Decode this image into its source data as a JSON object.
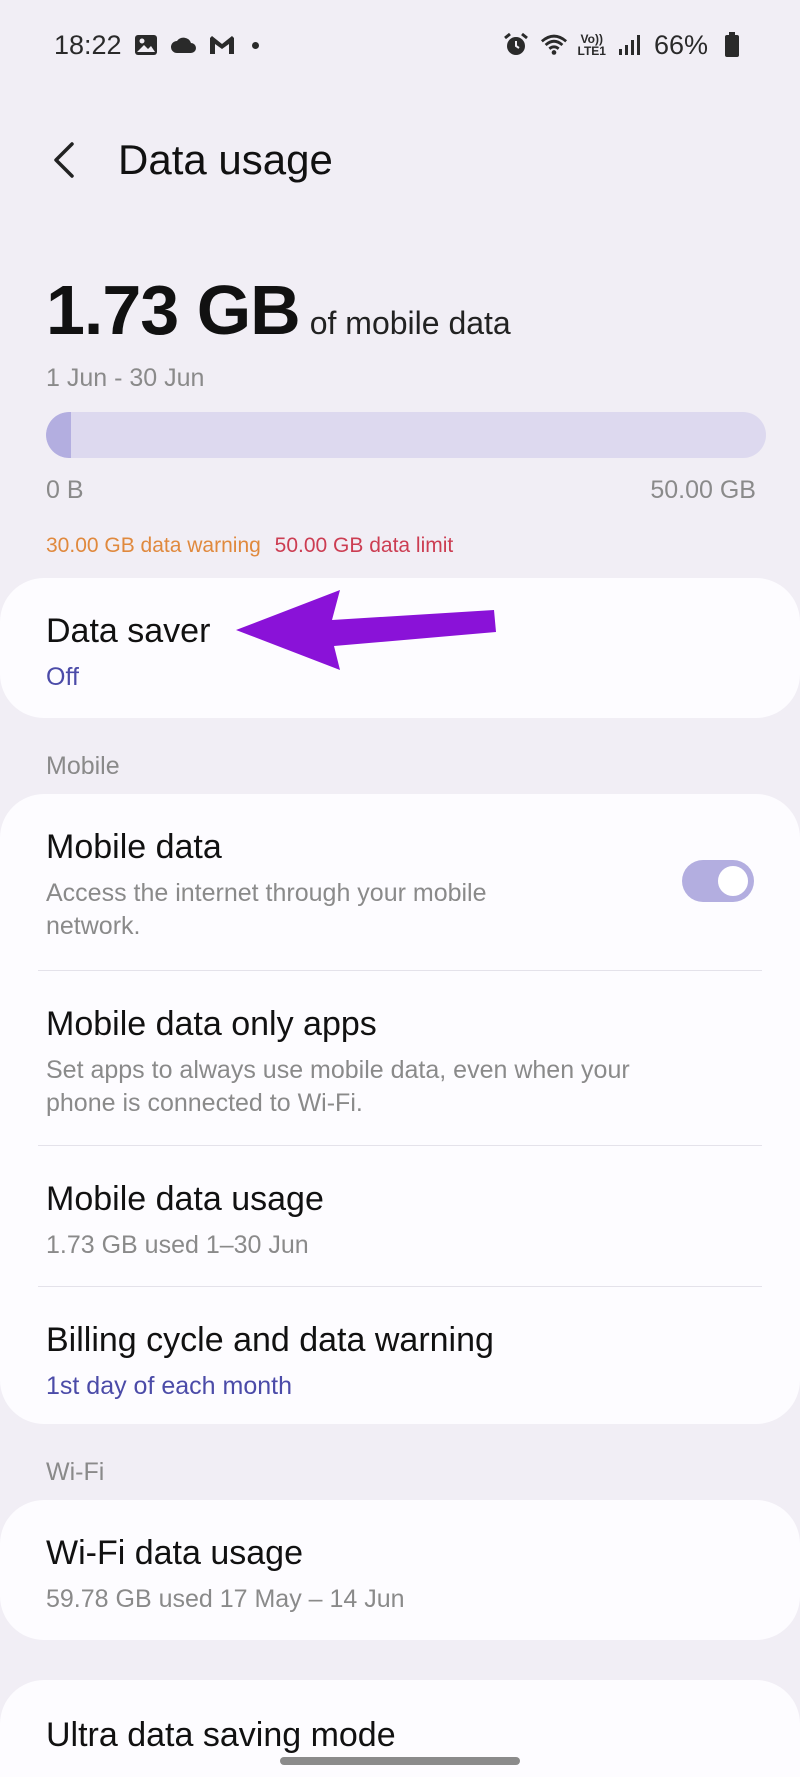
{
  "status_bar": {
    "time": "18:22",
    "left_icons": [
      "gallery-icon",
      "cloud-icon",
      "gmail-icon"
    ],
    "right_icons": [
      "alarm-icon",
      "wifi-icon",
      "volte-lte-icon",
      "signal-icon"
    ],
    "volte_top": "Vo))",
    "volte_bottom": "LTE1",
    "battery": "66%"
  },
  "header": {
    "title": "Data usage",
    "back_icon": "chevron-left-icon"
  },
  "usage": {
    "amount": "1.73 GB",
    "suffix": "of mobile data",
    "period": "1 Jun - 30 Jun",
    "bar_min_label": "0 B",
    "bar_max_label": "50.00 GB",
    "used_fraction": 0.035,
    "warning_text": "30.00 GB data warning",
    "limit_text": "50.00 GB data limit",
    "colors": {
      "warning": "#e0893d",
      "limit": "#cc3d52",
      "accent": "#4b4ba8",
      "bar_fill": "#b3aee0"
    }
  },
  "data_saver": {
    "title": "Data saver",
    "status": "Off"
  },
  "mobile_section": {
    "label": "Mobile",
    "items": [
      {
        "title": "Mobile data",
        "subtitle": "Access the internet through your mobile network.",
        "toggle_on": true
      },
      {
        "title": "Mobile data only apps",
        "subtitle": "Set apps to always use mobile data, even when your phone is connected to Wi-Fi."
      },
      {
        "title": "Mobile data usage",
        "subtitle": "1.73 GB used 1–30 Jun"
      },
      {
        "title": "Billing cycle and data warning",
        "subtitle": "1st day of each month"
      }
    ]
  },
  "wifi_section": {
    "label": "Wi-Fi",
    "items": [
      {
        "title": "Wi-Fi data usage",
        "subtitle": "59.78 GB used 17 May – 14 Jun"
      }
    ]
  },
  "extra": {
    "title": "Ultra data saving mode"
  },
  "annotation": {
    "icon": "purple-arrow-icon",
    "color": "#8a12d8"
  }
}
